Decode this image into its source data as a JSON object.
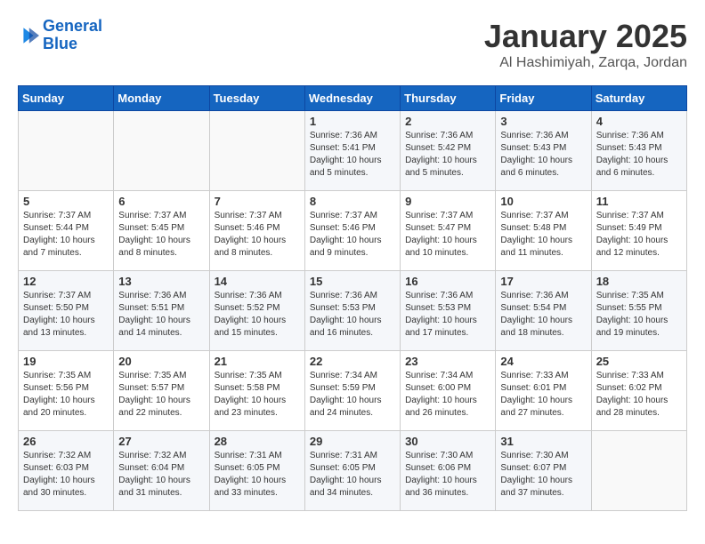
{
  "header": {
    "logo_line1": "General",
    "logo_line2": "Blue",
    "title": "January 2025",
    "subtitle": "Al Hashimiyah, Zarqa, Jordan"
  },
  "weekdays": [
    "Sunday",
    "Monday",
    "Tuesday",
    "Wednesday",
    "Thursday",
    "Friday",
    "Saturday"
  ],
  "weeks": [
    [
      {
        "day": "",
        "info": ""
      },
      {
        "day": "",
        "info": ""
      },
      {
        "day": "",
        "info": ""
      },
      {
        "day": "1",
        "info": "Sunrise: 7:36 AM\nSunset: 5:41 PM\nDaylight: 10 hours\nand 5 minutes."
      },
      {
        "day": "2",
        "info": "Sunrise: 7:36 AM\nSunset: 5:42 PM\nDaylight: 10 hours\nand 5 minutes."
      },
      {
        "day": "3",
        "info": "Sunrise: 7:36 AM\nSunset: 5:43 PM\nDaylight: 10 hours\nand 6 minutes."
      },
      {
        "day": "4",
        "info": "Sunrise: 7:36 AM\nSunset: 5:43 PM\nDaylight: 10 hours\nand 6 minutes."
      }
    ],
    [
      {
        "day": "5",
        "info": "Sunrise: 7:37 AM\nSunset: 5:44 PM\nDaylight: 10 hours\nand 7 minutes."
      },
      {
        "day": "6",
        "info": "Sunrise: 7:37 AM\nSunset: 5:45 PM\nDaylight: 10 hours\nand 8 minutes."
      },
      {
        "day": "7",
        "info": "Sunrise: 7:37 AM\nSunset: 5:46 PM\nDaylight: 10 hours\nand 8 minutes."
      },
      {
        "day": "8",
        "info": "Sunrise: 7:37 AM\nSunset: 5:46 PM\nDaylight: 10 hours\nand 9 minutes."
      },
      {
        "day": "9",
        "info": "Sunrise: 7:37 AM\nSunset: 5:47 PM\nDaylight: 10 hours\nand 10 minutes."
      },
      {
        "day": "10",
        "info": "Sunrise: 7:37 AM\nSunset: 5:48 PM\nDaylight: 10 hours\nand 11 minutes."
      },
      {
        "day": "11",
        "info": "Sunrise: 7:37 AM\nSunset: 5:49 PM\nDaylight: 10 hours\nand 12 minutes."
      }
    ],
    [
      {
        "day": "12",
        "info": "Sunrise: 7:37 AM\nSunset: 5:50 PM\nDaylight: 10 hours\nand 13 minutes."
      },
      {
        "day": "13",
        "info": "Sunrise: 7:36 AM\nSunset: 5:51 PM\nDaylight: 10 hours\nand 14 minutes."
      },
      {
        "day": "14",
        "info": "Sunrise: 7:36 AM\nSunset: 5:52 PM\nDaylight: 10 hours\nand 15 minutes."
      },
      {
        "day": "15",
        "info": "Sunrise: 7:36 AM\nSunset: 5:53 PM\nDaylight: 10 hours\nand 16 minutes."
      },
      {
        "day": "16",
        "info": "Sunrise: 7:36 AM\nSunset: 5:53 PM\nDaylight: 10 hours\nand 17 minutes."
      },
      {
        "day": "17",
        "info": "Sunrise: 7:36 AM\nSunset: 5:54 PM\nDaylight: 10 hours\nand 18 minutes."
      },
      {
        "day": "18",
        "info": "Sunrise: 7:35 AM\nSunset: 5:55 PM\nDaylight: 10 hours\nand 19 minutes."
      }
    ],
    [
      {
        "day": "19",
        "info": "Sunrise: 7:35 AM\nSunset: 5:56 PM\nDaylight: 10 hours\nand 20 minutes."
      },
      {
        "day": "20",
        "info": "Sunrise: 7:35 AM\nSunset: 5:57 PM\nDaylight: 10 hours\nand 22 minutes."
      },
      {
        "day": "21",
        "info": "Sunrise: 7:35 AM\nSunset: 5:58 PM\nDaylight: 10 hours\nand 23 minutes."
      },
      {
        "day": "22",
        "info": "Sunrise: 7:34 AM\nSunset: 5:59 PM\nDaylight: 10 hours\nand 24 minutes."
      },
      {
        "day": "23",
        "info": "Sunrise: 7:34 AM\nSunset: 6:00 PM\nDaylight: 10 hours\nand 26 minutes."
      },
      {
        "day": "24",
        "info": "Sunrise: 7:33 AM\nSunset: 6:01 PM\nDaylight: 10 hours\nand 27 minutes."
      },
      {
        "day": "25",
        "info": "Sunrise: 7:33 AM\nSunset: 6:02 PM\nDaylight: 10 hours\nand 28 minutes."
      }
    ],
    [
      {
        "day": "26",
        "info": "Sunrise: 7:32 AM\nSunset: 6:03 PM\nDaylight: 10 hours\nand 30 minutes."
      },
      {
        "day": "27",
        "info": "Sunrise: 7:32 AM\nSunset: 6:04 PM\nDaylight: 10 hours\nand 31 minutes."
      },
      {
        "day": "28",
        "info": "Sunrise: 7:31 AM\nSunset: 6:05 PM\nDaylight: 10 hours\nand 33 minutes."
      },
      {
        "day": "29",
        "info": "Sunrise: 7:31 AM\nSunset: 6:05 PM\nDaylight: 10 hours\nand 34 minutes."
      },
      {
        "day": "30",
        "info": "Sunrise: 7:30 AM\nSunset: 6:06 PM\nDaylight: 10 hours\nand 36 minutes."
      },
      {
        "day": "31",
        "info": "Sunrise: 7:30 AM\nSunset: 6:07 PM\nDaylight: 10 hours\nand 37 minutes."
      },
      {
        "day": "",
        "info": ""
      }
    ]
  ]
}
